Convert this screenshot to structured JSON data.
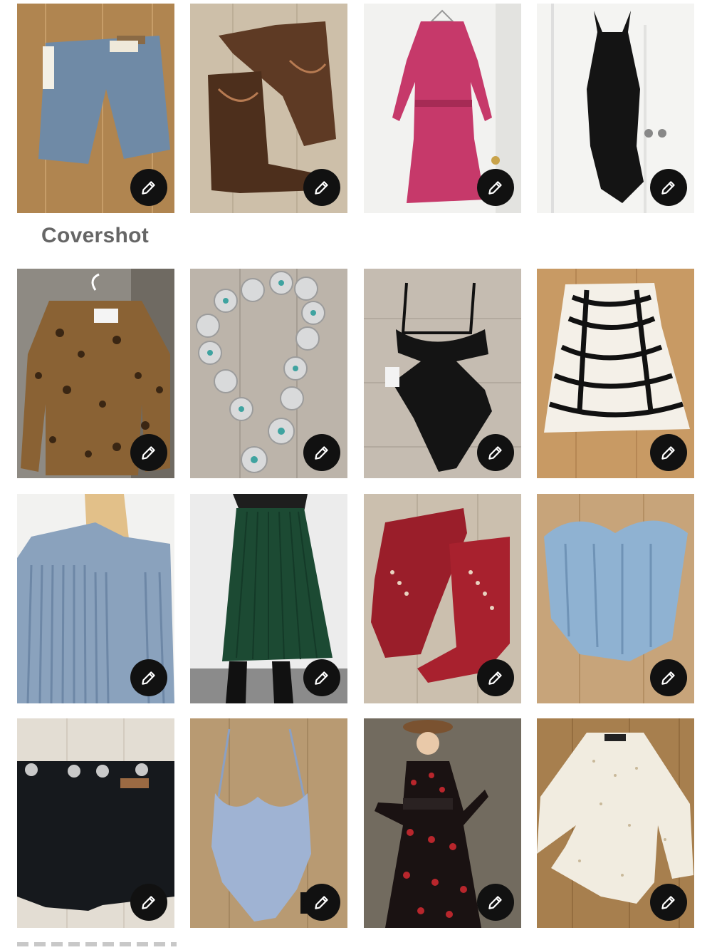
{
  "section_label": "Covershot",
  "tiles": [
    {
      "icon": "denim-shorts"
    },
    {
      "icon": "brown-cowboy-boots"
    },
    {
      "icon": "pink-floral-dress"
    },
    {
      "icon": "black-slip-dress"
    },
    {
      "icon": "leopard-blazer"
    },
    {
      "icon": "concho-belt"
    },
    {
      "icon": "black-cutout-swimsuit"
    },
    {
      "icon": "zebra-skirt"
    },
    {
      "icon": "fringe-denim-jacket"
    },
    {
      "icon": "green-pleated-skirt"
    },
    {
      "icon": "red-cowboy-boots"
    },
    {
      "icon": "denim-corset-top"
    },
    {
      "icon": "black-denim-shorts"
    },
    {
      "icon": "gingham-swimsuit"
    },
    {
      "icon": "floral-maxi-dress"
    },
    {
      "icon": "white-wrap-blouse"
    }
  ],
  "edit_icon": "pencil-icon"
}
